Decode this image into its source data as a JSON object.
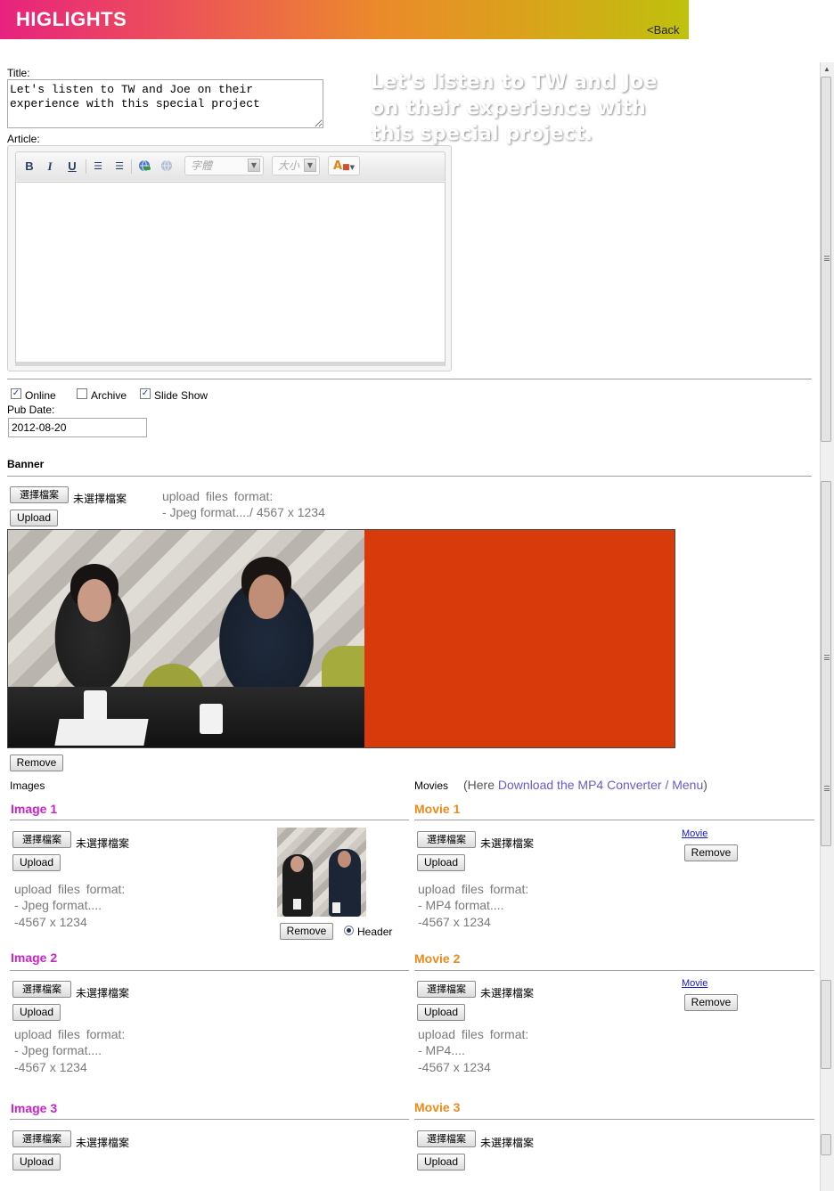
{
  "header": {
    "title": "HIGLIGHTS",
    "back": "<Back"
  },
  "form": {
    "title_label": "Title:",
    "title_value": "Let's listen to TW and Joe on their\nexperience with this special project",
    "article_label": "Article:",
    "toolbar": {
      "bold": "B",
      "italic": "I",
      "underline": "U",
      "font_placeholder": "字體",
      "size_placeholder": "大小",
      "color_label": "A"
    },
    "online_label": "Online",
    "online_checked": true,
    "archive_label": "Archive",
    "archive_checked": false,
    "slideshow_label": "Slide Show",
    "slideshow_checked": true,
    "pubdate_label": "Pub Date:",
    "pubdate_value": "2012-08-20"
  },
  "banner": {
    "heading": "Banner",
    "choose_file": "選擇檔案",
    "no_file": "未選擇檔案",
    "upload": "Upload",
    "format_line1": "upload  files  format:",
    "format_line2": "- Jpeg format..../ 4567 x 1234",
    "image_text": "Let's listen to TW and Joe on their experience with this special project.",
    "remove": "Remove"
  },
  "images": {
    "heading": "Images",
    "items": [
      {
        "title": "Image 1",
        "choose_file": "選擇檔案",
        "no_file": "未選擇檔案",
        "upload": "Upload",
        "format_line1": "upload  files  format:",
        "format_line2": "- Jpeg format....",
        "format_line3": "-4567 x 1234",
        "remove": "Remove",
        "radio_label": "Header"
      },
      {
        "title": "Image 2",
        "choose_file": "選擇檔案",
        "no_file": "未選擇檔案",
        "upload": "Upload",
        "format_line1": "upload  files  format:",
        "format_line2": "- Jpeg format....",
        "format_line3": "-4567 x 1234"
      },
      {
        "title": "Image 3",
        "choose_file": "選擇檔案",
        "no_file": "未選擇檔案",
        "upload": "Upload"
      }
    ]
  },
  "movies": {
    "heading": "Movies",
    "note_prefix": "(Here ",
    "note_link": "Download the MP4 Converter / Menu",
    "note_suffix": ")",
    "items": [
      {
        "title": "Movie 1",
        "choose_file": "選擇檔案",
        "no_file": "未選擇檔案",
        "upload": "Upload",
        "format_line1": "upload  files  format:",
        "format_line2": "- MP4 format....",
        "format_line3": "-4567 x 1234",
        "link": "Movie",
        "remove": "Remove"
      },
      {
        "title": "Movie 2",
        "choose_file": "選擇檔案",
        "no_file": "未選擇檔案",
        "upload": "Upload",
        "format_line1": "upload  files  format:",
        "format_line2": "- MP4....",
        "format_line3": "-4567 x 1234",
        "link": "Movie",
        "remove": "Remove"
      },
      {
        "title": "Movie 3",
        "choose_file": "選擇檔案",
        "no_file": "未選擇檔案",
        "upload": "Upload"
      }
    ]
  },
  "colors": {
    "accent_image": "#cc22cc",
    "accent_movie": "#ee8a1a",
    "banner_red": "#d93a0b"
  }
}
